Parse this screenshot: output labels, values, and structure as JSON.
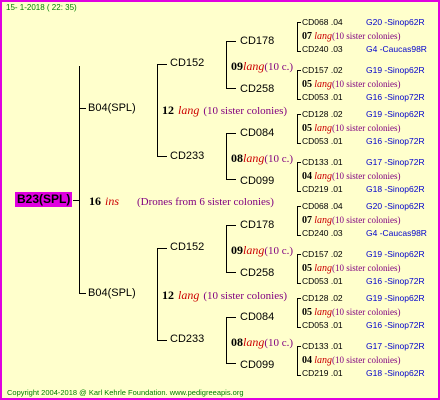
{
  "date": "15- 1-2018 ( 22: 35)",
  "root": {
    "label": "B23(SPL)",
    "number": "16",
    "race": "ins",
    "note": "(Drones from 6 sister colonies)"
  },
  "mothers": [
    {
      "label": "B04(SPL)",
      "number": "12",
      "race": "lang",
      "note": "(10 sister colonies)",
      "children": [
        {
          "label": "CD152",
          "number": "09",
          "race": "lang",
          "note": "(10 c.)",
          "children": [
            {
              "label": "CD178",
              "number": "07",
              "race": "lang",
              "note": "(10 sister colonies)",
              "top": {
                "id": "CD068",
                "num": ".04",
                "code": "G20 -Sinop62R"
              },
              "bottom": {
                "id": "CD240",
                "num": ".03",
                "code": "G4 -Caucas98R"
              }
            },
            {
              "label": "CD258",
              "number": "05",
              "race": "lang",
              "note": "(10 sister colonies)",
              "top": {
                "id": "CD157",
                "num": ".02",
                "code": "G19 -Sinop62R"
              },
              "bottom": {
                "id": "CD053",
                "num": ".01",
                "code": "G16 -Sinop72R"
              }
            }
          ]
        },
        {
          "label": "CD233",
          "number": "08",
          "race": "lang",
          "note": "(10 c.)",
          "children": [
            {
              "label": "CD084",
              "number": "05",
              "race": "lang",
              "note": "(10 sister colonies)",
              "top": {
                "id": "CD128",
                "num": ".02",
                "code": "G19 -Sinop62R"
              },
              "bottom": {
                "id": "CD053",
                "num": ".01",
                "code": "G16 -Sinop72R"
              }
            },
            {
              "label": "CD099",
              "number": "04",
              "race": "lang",
              "note": "(10 sister colonies)",
              "top": {
                "id": "CD133",
                "num": ".01",
                "code": "G17 -Sinop72R"
              },
              "bottom": {
                "id": "CD219",
                "num": ".01",
                "code": "G18 -Sinop62R"
              }
            }
          ]
        }
      ]
    },
    {
      "label": "B04(SPL)",
      "number": "12",
      "race": "lang",
      "note": "(10 sister colonies)",
      "children": [
        {
          "label": "CD152",
          "number": "09",
          "race": "lang",
          "note": "(10 c.)",
          "children": [
            {
              "label": "CD178",
              "number": "07",
              "race": "lang",
              "note": "(10 sister colonies)",
              "top": {
                "id": "CD068",
                "num": ".04",
                "code": "G20 -Sinop62R"
              },
              "bottom": {
                "id": "CD240",
                "num": ".03",
                "code": "G4 -Caucas98R"
              }
            },
            {
              "label": "CD258",
              "number": "05",
              "race": "lang",
              "note": "(10 sister colonies)",
              "top": {
                "id": "CD157",
                "num": ".02",
                "code": "G19 -Sinop62R"
              },
              "bottom": {
                "id": "CD053",
                "num": ".01",
                "code": "G16 -Sinop72R"
              }
            }
          ]
        },
        {
          "label": "CD233",
          "number": "08",
          "race": "lang",
          "note": "(10 c.)",
          "children": [
            {
              "label": "CD084",
              "number": "05",
              "race": "lang",
              "note": "(10 sister colonies)",
              "top": {
                "id": "CD128",
                "num": ".02",
                "code": "G19 -Sinop62R"
              },
              "bottom": {
                "id": "CD053",
                "num": ".01",
                "code": "G16 -Sinop72R"
              }
            },
            {
              "label": "CD099",
              "number": "04",
              "race": "lang",
              "note": "(10 sister colonies)",
              "top": {
                "id": "CD133",
                "num": ".01",
                "code": "G17 -Sinop72R"
              },
              "bottom": {
                "id": "CD219",
                "num": ".01",
                "code": "G18 -Sinop62R"
              }
            }
          ]
        }
      ]
    }
  ],
  "copyright": "Copyright 2004-2018 @ Karl Kehrle Foundation.   www.pedigreeapis.org"
}
